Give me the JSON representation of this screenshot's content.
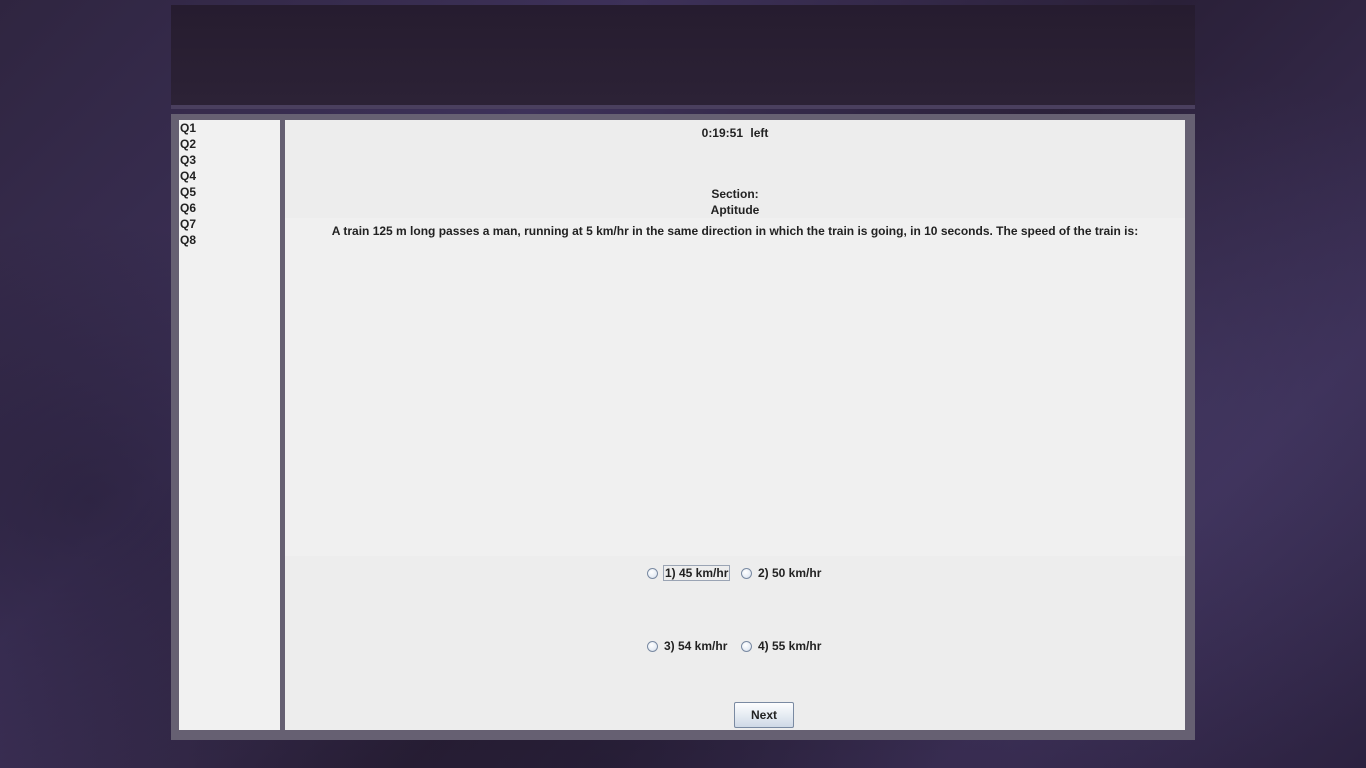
{
  "sidebar": {
    "questions": [
      "Q1",
      "Q2",
      "Q3",
      "Q4",
      "Q5",
      "Q6",
      "Q7",
      "Q8"
    ]
  },
  "timer": {
    "value": "0:19:51",
    "suffix": "left"
  },
  "section": {
    "label": "Section:",
    "name": "Aptitude"
  },
  "question": {
    "text": "A train 125 m long passes a man, running at 5 km/hr in the same direction in which the train is going, in 10 seconds. The speed of the train is:"
  },
  "options": [
    {
      "label": "1) 45 km/hr",
      "selected": false,
      "focused": true
    },
    {
      "label": "2) 50 km/hr",
      "selected": false,
      "focused": false
    },
    {
      "label": "3) 54 km/hr",
      "selected": false,
      "focused": false
    },
    {
      "label": "4) 55 km/hr",
      "selected": false,
      "focused": false
    }
  ],
  "navigation": {
    "next_label": "Next"
  }
}
